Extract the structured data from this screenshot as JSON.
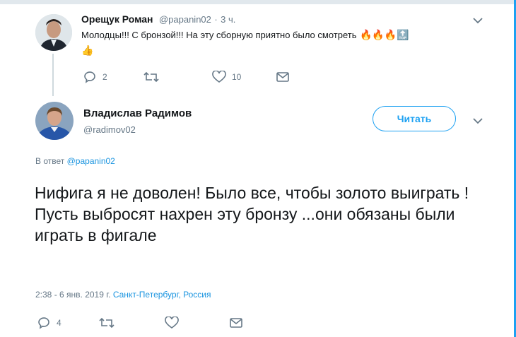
{
  "reply_tweet": {
    "author_name": "Орещук Роман",
    "author_handle": "@papanin02",
    "separator": "·",
    "time": "3 ч.",
    "text": "Молодцы!!! С бронзой!!! На эту сборную приятно было смотреть",
    "emojis": [
      "🔥",
      "🔥",
      "🔥",
      "🔝",
      "👍"
    ],
    "replies_count": "2",
    "retweets_count": "",
    "likes_count": "10"
  },
  "main_tweet": {
    "author_name": "Владислав Радимов",
    "author_handle": "@radimov02",
    "follow_label": "Читать",
    "reply_to_prefix": "В ответ",
    "reply_to_handle": "@papanin02",
    "text": "Нифига я не доволен! Было все, чтобы золото выиграть ! Пусть выбросят нахрен эту бронзу ...они обязаны были играть в фигале",
    "timestamp": "2:38 - 6 янв. 2019 г.",
    "location": "Санкт-Петербург, Россия",
    "replies_count": "4",
    "retweets_count": "",
    "likes_count": ""
  },
  "colors": {
    "accent": "#1da1f2",
    "link": "#1b95e0",
    "muted": "#657786",
    "text": "#14171a"
  }
}
